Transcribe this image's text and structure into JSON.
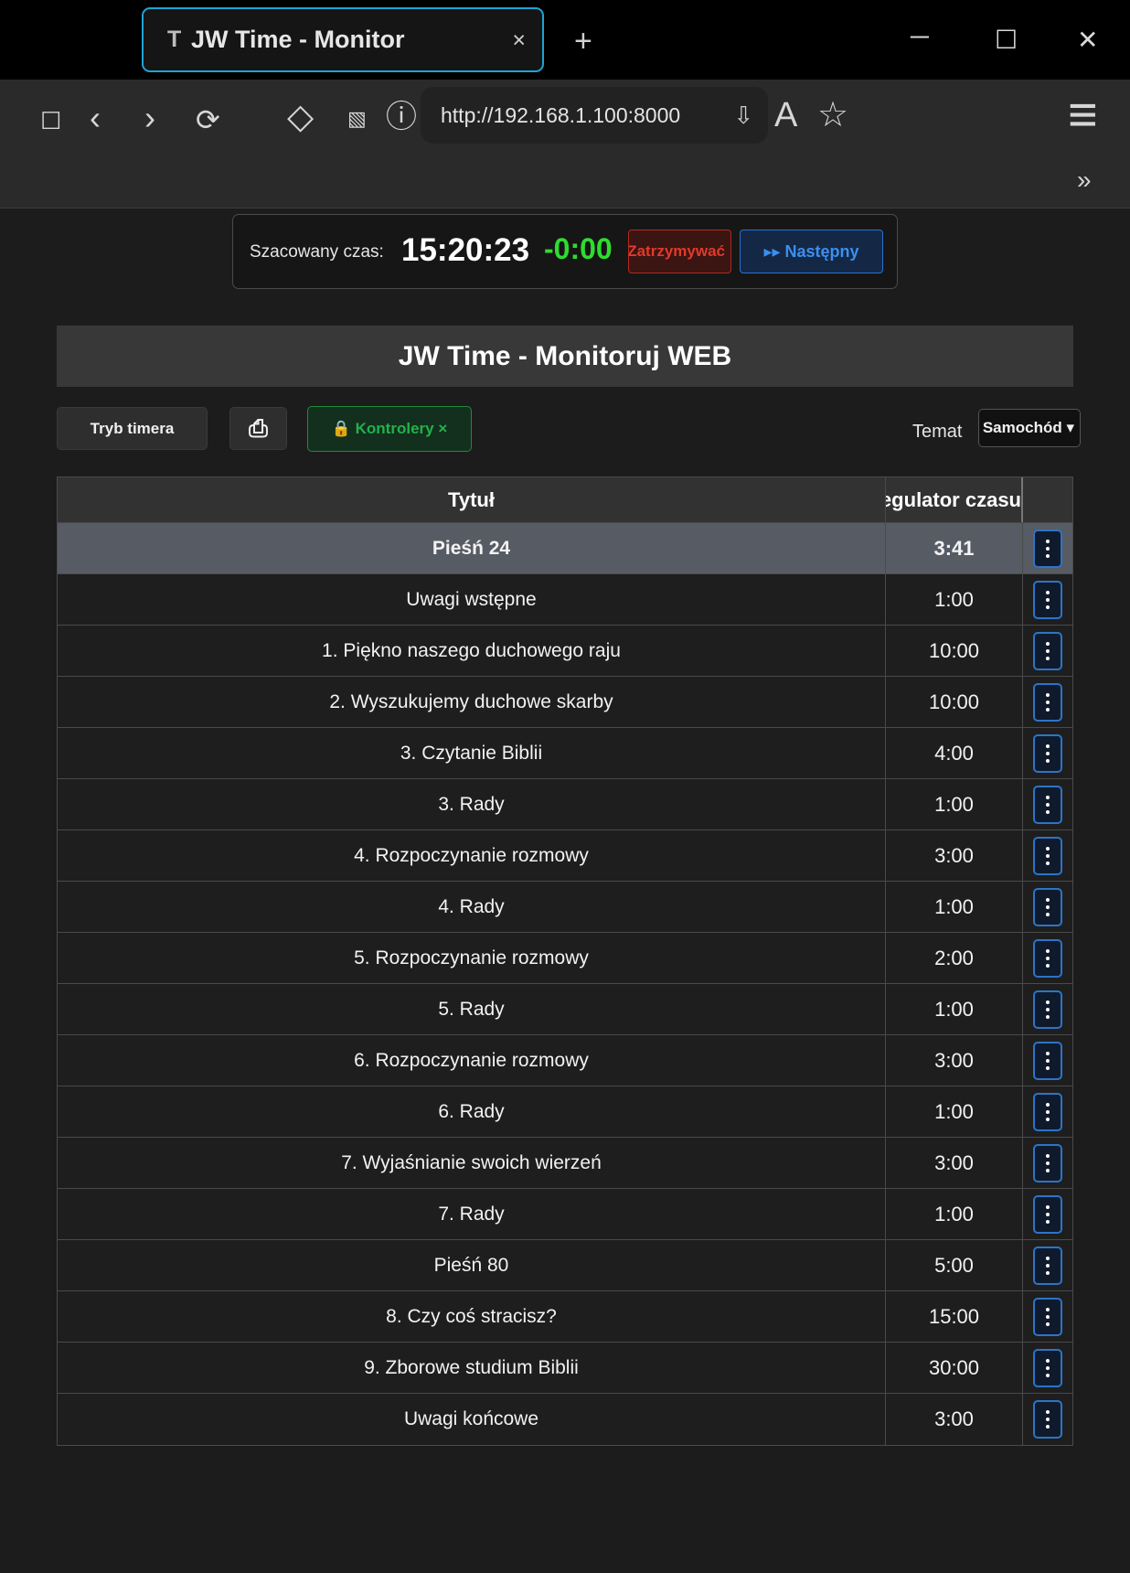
{
  "browser": {
    "tab_icon": "T",
    "tab_title": "JW Time - Monitor",
    "tab_close": "×",
    "new_tab": "+",
    "minimize": "─",
    "maximize": "☐",
    "close": "✕",
    "url": "http://192.168.1.100:8000",
    "icons": {
      "sidebar": "☐",
      "back": "‹",
      "forward": "›",
      "reload": "⟳",
      "diamond": "◇",
      "reader": "▧",
      "site_info": "ⓘ",
      "download": "⇩",
      "text_size": "A",
      "bookmark": "☆",
      "menu": "≡",
      "more": "»"
    }
  },
  "estimate": {
    "label": "Szacowany czas:",
    "time": "15:20:23",
    "diff": "-0:00",
    "stop_label": "Zatrzymywać",
    "next_label": "▸▸ Następny"
  },
  "header": {
    "title": "JW Time - Monitoruj WEB"
  },
  "controls": {
    "timer_mode": "Tryb timera",
    "print_icon": "⎙",
    "controllers": "🔒 Kontrolery ×",
    "theme_label": "Temat",
    "theme_value": "Samochód ▾"
  },
  "table": {
    "headers": {
      "title": "Tytuł",
      "time": "Regulator czasu"
    },
    "rows": [
      {
        "title": "Pieśń 24",
        "time": "3:41",
        "active": true
      },
      {
        "title": "Uwagi wstępne",
        "time": "1:00"
      },
      {
        "title": "1. Piękno naszego duchowego raju",
        "time": "10:00"
      },
      {
        "title": "2. Wyszukujemy duchowe skarby",
        "time": "10:00"
      },
      {
        "title": "3. Czytanie Biblii",
        "time": "4:00"
      },
      {
        "title": "3. Rady",
        "time": "1:00"
      },
      {
        "title": "4. Rozpoczynanie rozmowy",
        "time": "3:00"
      },
      {
        "title": "4. Rady",
        "time": "1:00"
      },
      {
        "title": "5. Rozpoczynanie rozmowy",
        "time": "2:00"
      },
      {
        "title": "5. Rady",
        "time": "1:00"
      },
      {
        "title": "6. Rozpoczynanie rozmowy",
        "time": "3:00"
      },
      {
        "title": "6. Rady",
        "time": "1:00"
      },
      {
        "title": "7. Wyjaśnianie swoich wierzeń",
        "time": "3:00"
      },
      {
        "title": "7. Rady",
        "time": "1:00"
      },
      {
        "title": "Pieśń 80",
        "time": "5:00"
      },
      {
        "title": "8. Czy coś stracisz?",
        "time": "15:00"
      },
      {
        "title": "9. Zborowe studium Biblii",
        "time": "30:00"
      },
      {
        "title": "Uwagi końcowe",
        "time": "3:00"
      }
    ]
  }
}
